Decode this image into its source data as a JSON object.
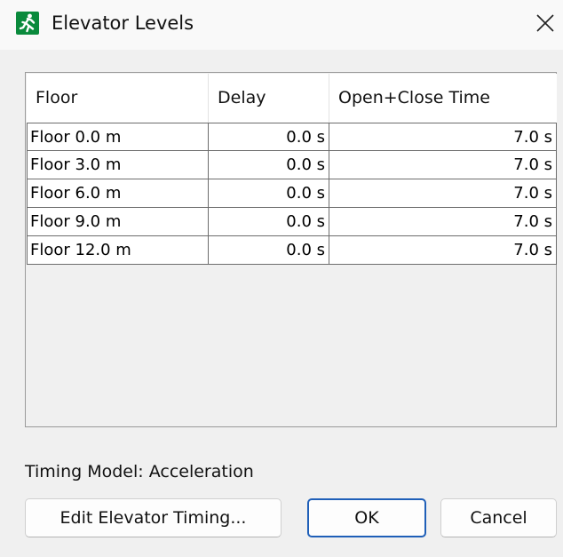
{
  "window": {
    "title": "Elevator Levels",
    "icon": "running-man-exit-icon",
    "accent_color": "#0a8a3c"
  },
  "table": {
    "columns": [
      "Floor",
      "Delay",
      "Open+Close Time"
    ],
    "rows": [
      {
        "floor": "Floor 0.0 m",
        "delay": "0.0 s",
        "time": "7.0 s"
      },
      {
        "floor": "Floor 3.0 m",
        "delay": "0.0 s",
        "time": "7.0 s"
      },
      {
        "floor": "Floor 6.0 m",
        "delay": "0.0 s",
        "time": "7.0 s"
      },
      {
        "floor": "Floor 9.0 m",
        "delay": "0.0 s",
        "time": "7.0 s"
      },
      {
        "floor": "Floor 12.0 m",
        "delay": "0.0 s",
        "time": "7.0 s"
      }
    ]
  },
  "timing_model": "Timing Model: Acceleration",
  "buttons": {
    "edit_timing": "Edit Elevator Timing...",
    "ok": "OK",
    "cancel": "Cancel",
    "focus_color": "#1f5fb8"
  }
}
